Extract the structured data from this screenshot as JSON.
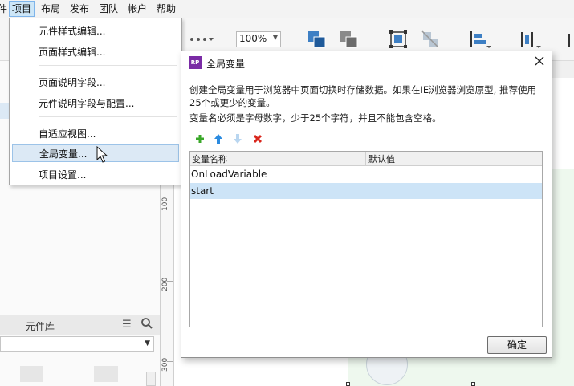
{
  "menubar": {
    "items": [
      {
        "label": "件"
      },
      {
        "label": "项目"
      },
      {
        "label": "布局"
      },
      {
        "label": "发布"
      },
      {
        "label": "团队"
      },
      {
        "label": "帐户"
      },
      {
        "label": "帮助"
      }
    ]
  },
  "toolbar": {
    "zoom_value": "100%"
  },
  "project_menu": {
    "items": [
      {
        "label": "元件样式编辑..."
      },
      {
        "label": "页面样式编辑..."
      },
      {
        "label": "页面说明字段..."
      },
      {
        "label": "元件说明字段与配置..."
      },
      {
        "label": "自适应视图..."
      },
      {
        "label": "全局变量..."
      },
      {
        "label": "项目设置..."
      }
    ]
  },
  "library_panel": {
    "title": "元件库"
  },
  "ruler": {
    "labels": [
      "100",
      "200",
      "300"
    ]
  },
  "dialog": {
    "logo_text": "RP",
    "title": "全局变量",
    "description": "创建全局变量用于浏览器中页面切换时存储数据。如果在IE浏览器浏览原型, 推荐使用25个或更少的变量。",
    "rule": "变量名必须是字母数字，少于25个字符，并且不能包含空格。",
    "columns": [
      "变量名称",
      "默认值"
    ],
    "rows": [
      {
        "name": "OnLoadVariable",
        "default": ""
      },
      {
        "name": "start",
        "default": ""
      }
    ],
    "ok_label": "确定"
  },
  "colors": {
    "selection": "#cde4f7",
    "add": "#3aa829",
    "arrow_up": "#2b8be0",
    "delete": "#d9261c",
    "logo": "#7a2ba5"
  }
}
